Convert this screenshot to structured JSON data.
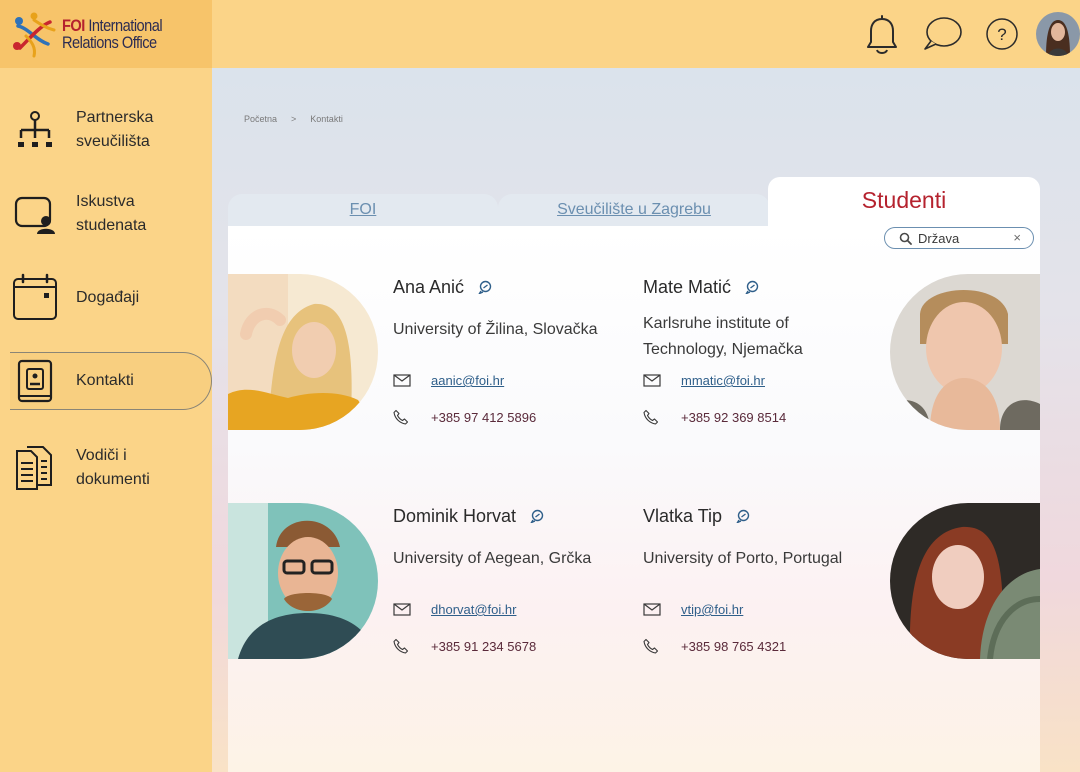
{
  "brand": {
    "name_highlight": "FOI",
    "name_rest": " International",
    "name_line2": "Relations Office"
  },
  "topbar": {
    "icons": [
      "bell-icon",
      "chat-bubble-icon",
      "help-icon",
      "user-avatar"
    ]
  },
  "sidebar": {
    "items": [
      {
        "label": "Partnerska\nsveučilišta",
        "icon": "org-chart-icon"
      },
      {
        "label": "Iskustva\nstudenata",
        "icon": "user-card-icon"
      },
      {
        "label": "Događaji",
        "icon": "calendar-icon"
      },
      {
        "label": "Kontakti",
        "icon": "contact-book-icon",
        "active": true
      },
      {
        "label": "Vodiči i\ndokumenti",
        "icon": "documents-icon"
      }
    ]
  },
  "breadcrumb": {
    "home": "Početna",
    "separator": ">",
    "current": "Kontakti"
  },
  "tabs": [
    {
      "label": "FOI"
    },
    {
      "label": "Sveučilište u Zagrebu"
    },
    {
      "label": "Studenti",
      "active": true
    }
  ],
  "search": {
    "placeholder": "Država",
    "clear": "×"
  },
  "contacts": [
    {
      "name": "Ana Anić",
      "university": "University of Žilina, Slovačka",
      "email": "aanic@foi.hr",
      "phone": "+385 97 412 5896"
    },
    {
      "name": "Mate Matić",
      "university": "Karlsruhe institute of\nTechnology, Njemačka",
      "email": "mmatic@foi.hr",
      "phone": "+385 92 369 8514"
    },
    {
      "name": "Dominik Horvat",
      "university": "University of Aegean, Grčka",
      "email": "dhorvat@foi.hr",
      "phone": "+385 91 234 5678"
    },
    {
      "name": "Vlatka Tip",
      "university": "University of Porto, Portugal",
      "email": "vtip@foi.hr",
      "phone": "+385 98 765 4321"
    }
  ],
  "colors": {
    "accent": "#b5222e",
    "sidebar": "#fbd488",
    "link": "#2f5f8a",
    "tab_text": "#6b8fb0"
  }
}
